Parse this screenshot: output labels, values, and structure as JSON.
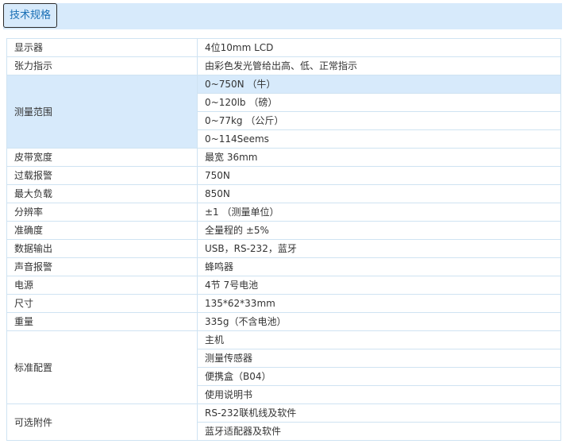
{
  "header": {
    "tab_label": "技术规格"
  },
  "specs": [
    {
      "label": "显示器",
      "values": [
        "4位10mm LCD"
      ]
    },
    {
      "label": "张力指示",
      "values": [
        "由彩色发光管给出高、低、正常指示"
      ]
    },
    {
      "label": "测量范围",
      "values": [
        "0~750N （牛）",
        "0~120lb （磅）",
        "0~77kg （公斤）",
        "0~114Seems"
      ],
      "highlighted": true
    },
    {
      "label": "皮带宽度",
      "values": [
        "最宽 36mm"
      ]
    },
    {
      "label": "过载报警",
      "values": [
        "750N"
      ]
    },
    {
      "label": "最大负载",
      "values": [
        "850N"
      ]
    },
    {
      "label": "分辨率",
      "values": [
        "±1 （测量单位）"
      ]
    },
    {
      "label": "准确度",
      "values": [
        "全量程的 ±5%"
      ]
    },
    {
      "label": "数据输出",
      "values": [
        "USB，RS-232，蓝牙"
      ]
    },
    {
      "label": "声音报警",
      "values": [
        "蜂鸣器"
      ]
    },
    {
      "label": "电源",
      "values": [
        "4节 7号电池"
      ]
    },
    {
      "label": "尺寸",
      "values": [
        "135*62*33mm"
      ]
    },
    {
      "label": "重量",
      "values": [
        "335g（不含电池）"
      ]
    },
    {
      "label": "标准配置",
      "values": [
        "主机",
        "测量传感器",
        "便携盒（B04）",
        "使用说明书"
      ]
    },
    {
      "label": "可选附件",
      "values": [
        "RS-232联机线及软件",
        "蓝牙适配器及软件"
      ]
    }
  ]
}
